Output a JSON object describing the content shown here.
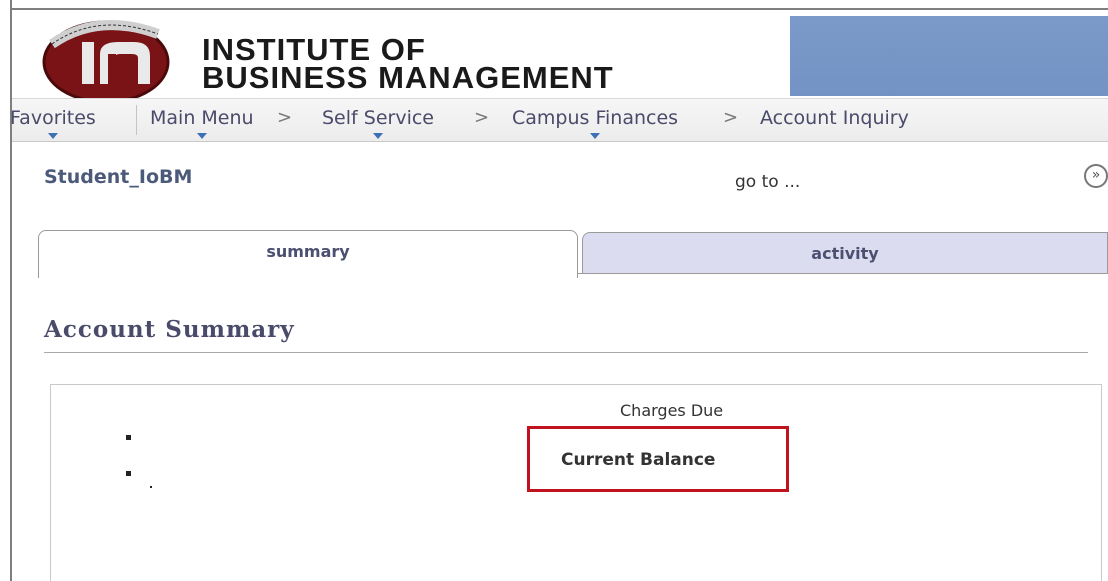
{
  "header": {
    "institute_name_line1": "INSTITUTE OF",
    "institute_name_line2": "BUSINESS MANAGEMENT",
    "logo_icon": "ibm-seal-logo",
    "accent_color": "#7293c4"
  },
  "nav": {
    "favorites": "Favorites",
    "main_menu": "Main Menu",
    "self_service": "Self Service",
    "campus_finances": "Campus Finances",
    "account_inquiry": "Account Inquiry",
    "separator": ">"
  },
  "page": {
    "student_name": "Student_IoBM",
    "goto_label": "go to ...",
    "goto_icon": "double-chevron-right-icon"
  },
  "tabs": [
    {
      "label": "summary",
      "active": true
    },
    {
      "label": "activity",
      "active": false
    }
  ],
  "section": {
    "title": "Account Summary"
  },
  "summary": {
    "charges_due": "Charges Due",
    "current_balance": "Current Balance",
    "highlight_color": "#c1121f"
  }
}
